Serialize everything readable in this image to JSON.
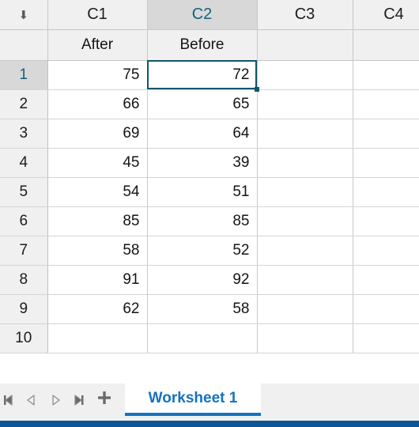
{
  "grid": {
    "corner_icon": "sort-arrow-down-icon",
    "corner_glyph": "⬇",
    "columns": [
      {
        "id": "C1",
        "label": "C1",
        "name": "After",
        "selected": false
      },
      {
        "id": "C2",
        "label": "C2",
        "name": "Before",
        "selected": true
      },
      {
        "id": "C3",
        "label": "C3",
        "name": "",
        "selected": false
      },
      {
        "id": "C4",
        "label": "C4",
        "name": "",
        "selected": false
      }
    ],
    "rows": [
      {
        "number": "1",
        "selected": true,
        "cells": [
          "75",
          "72",
          "",
          ""
        ]
      },
      {
        "number": "2",
        "selected": false,
        "cells": [
          "66",
          "65",
          "",
          ""
        ]
      },
      {
        "number": "3",
        "selected": false,
        "cells": [
          "69",
          "64",
          "",
          ""
        ]
      },
      {
        "number": "4",
        "selected": false,
        "cells": [
          "45",
          "39",
          "",
          ""
        ]
      },
      {
        "number": "5",
        "selected": false,
        "cells": [
          "54",
          "51",
          "",
          ""
        ]
      },
      {
        "number": "6",
        "selected": false,
        "cells": [
          "85",
          "85",
          "",
          ""
        ]
      },
      {
        "number": "7",
        "selected": false,
        "cells": [
          "58",
          "52",
          "",
          ""
        ]
      },
      {
        "number": "8",
        "selected": false,
        "cells": [
          "91",
          "92",
          "",
          ""
        ]
      },
      {
        "number": "9",
        "selected": false,
        "cells": [
          "62",
          "58",
          "",
          ""
        ]
      },
      {
        "number": "10",
        "selected": false,
        "cells": [
          "",
          "",
          "",
          ""
        ]
      }
    ],
    "active_cell": {
      "column": "C2",
      "row": "1",
      "value": "72"
    }
  },
  "tabbar": {
    "nav": [
      {
        "name": "first-sheet-button",
        "icon": "first-icon",
        "enabled": true
      },
      {
        "name": "previous-sheet-button",
        "icon": "previous-icon",
        "enabled": false
      },
      {
        "name": "next-sheet-button",
        "icon": "next-icon",
        "enabled": false
      },
      {
        "name": "last-sheet-button",
        "icon": "last-icon",
        "enabled": true
      }
    ],
    "add_label": "+",
    "add_icon": "plus-icon",
    "tabs": [
      {
        "label": "Worksheet 1",
        "active": true
      }
    ]
  },
  "colors": {
    "accent_blue": "#1572c0",
    "selection_teal": "#10566b",
    "header_text_selected": "#10627d",
    "statusbar": "#0f5495",
    "header_bg": "#f0f0f0",
    "header_bg_selected": "#d8d8d8",
    "gridline": "#d4d4d4"
  }
}
